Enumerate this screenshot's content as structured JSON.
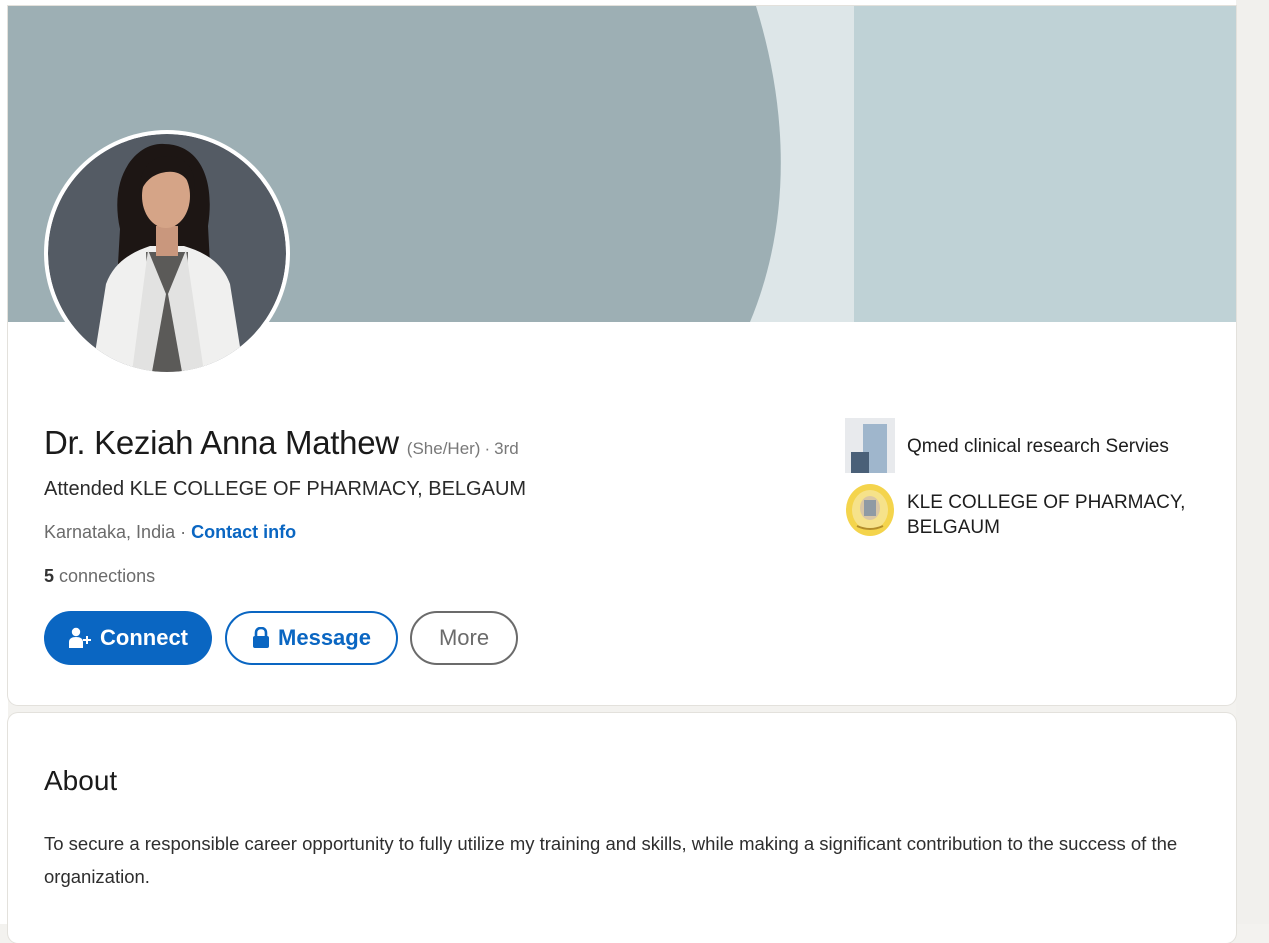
{
  "profile": {
    "name": "Dr. Keziah Anna Mathew",
    "pronouns": "(She/Her)",
    "separator": "·",
    "degree": "3rd",
    "headline": "Attended KLE COLLEGE OF PHARMACY, BELGAUM",
    "location": "Karnataka, India",
    "location_separator": "·",
    "contact_info_label": "Contact info",
    "connections_count": "5",
    "connections_label": "connections"
  },
  "actions": {
    "connect_label": "Connect",
    "message_label": "Message",
    "more_label": "More"
  },
  "affiliations": [
    {
      "name": "Qmed clinical research Servies",
      "logo_icon": "company-logo-icon"
    },
    {
      "name": "KLE COLLEGE OF PHARMACY, BELGAUM",
      "logo_icon": "college-seal-icon"
    }
  ],
  "about": {
    "title": "About",
    "text": "To secure a responsible career opportunity to fully utilize my training and skills, while making a significant contribution to the success of the organization."
  },
  "colors": {
    "primary": "#0a66c2",
    "banner": "#9dafb4",
    "page_background": "#f3f2ef"
  }
}
